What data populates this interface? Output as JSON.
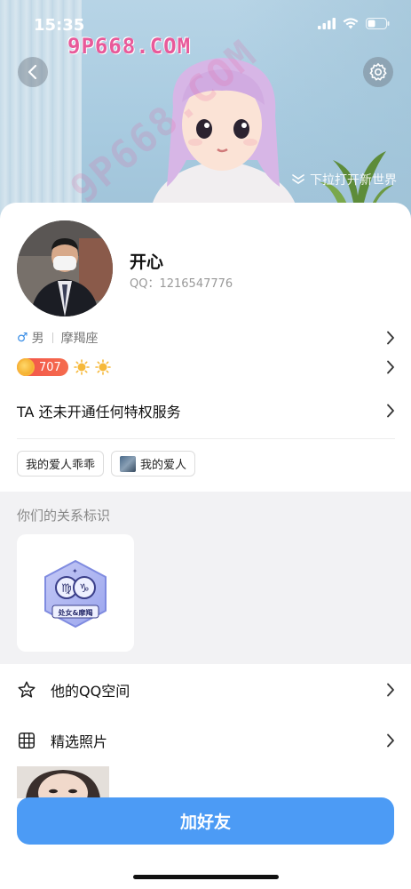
{
  "status_bar": {
    "time": "15:35"
  },
  "watermark": {
    "top_text": "9P668.COM",
    "diag_text": "9P668.COM"
  },
  "header": {
    "pull_hint": "下拉打开新世界"
  },
  "profile": {
    "nickname": "开心",
    "qq_label": "QQ：",
    "qq_number": "1216547776",
    "gender": "男",
    "gender_symbol": "♂",
    "zodiac": "摩羯座",
    "level_value": "707",
    "privilege_text": "TA 还未开通任何特权服务"
  },
  "tags": [
    {
      "label": "我的爱人乖乖"
    },
    {
      "label": "我的爱人"
    }
  ],
  "relationship": {
    "title": "你们的关系标识",
    "badge_caption": "处女&摩羯"
  },
  "menu": {
    "qzone_label": "他的QQ空间",
    "photos_label": "精选照片"
  },
  "actions": {
    "add_friend_label": "加好友"
  },
  "colors": {
    "primary_button": "#4c9bf5",
    "watermark": "#e85a9a",
    "coin": "#f2534a"
  }
}
